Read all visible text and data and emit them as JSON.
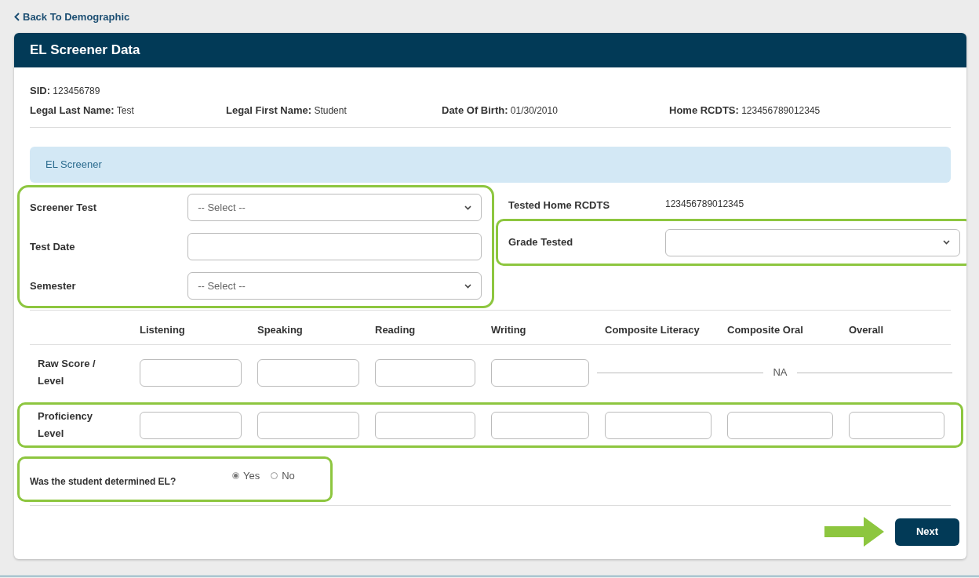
{
  "back_link": "Back To Demographic",
  "title": "EL Screener Data",
  "student_info": [
    {
      "label": "SID:",
      "value": "123456789"
    },
    {
      "label": "Legal Last Name:",
      "value": "Test"
    },
    {
      "label": "Legal First Name:",
      "value": "Student"
    },
    {
      "label": "Date Of Birth:",
      "value": "01/30/2010"
    },
    {
      "label": "Home RCDTS:",
      "value": "123456789012345"
    }
  ],
  "section_title": "EL Screener",
  "left_fields": {
    "highlighted": true,
    "fields": [
      {
        "label": "Screener Test",
        "kind": "select",
        "value": "-- Select --"
      },
      {
        "label": "Test Date",
        "kind": "text"
      },
      {
        "label": "Semester",
        "kind": "select",
        "value": "-- Select --"
      }
    ]
  },
  "right_fields": [
    {
      "label": "Tested Home RCDTS",
      "kind": "static",
      "value": "123456789012345",
      "highlighted": false
    },
    {
      "label": "Grade Tested",
      "kind": "select",
      "highlighted": true
    }
  ],
  "scores": {
    "columns": [
      "Listening",
      "Speaking",
      "Reading",
      "Writing",
      "Composite Literacy",
      "Composite Oral",
      "Overall"
    ],
    "rows": [
      {
        "label": "Raw Score / Level",
        "highlighted": false,
        "cells": [
          {
            "kind": "input"
          },
          {
            "kind": "input"
          },
          {
            "kind": "input"
          },
          {
            "kind": "input"
          },
          {
            "kind": "line"
          },
          {
            "kind": "na",
            "text": "NA"
          },
          {
            "kind": "line"
          }
        ]
      },
      {
        "label": "Proficiency Level",
        "highlighted": true,
        "cells": [
          {
            "kind": "input"
          },
          {
            "kind": "input"
          },
          {
            "kind": "input"
          },
          {
            "kind": "input"
          },
          {
            "kind": "input"
          },
          {
            "kind": "input"
          },
          {
            "kind": "input"
          }
        ]
      }
    ]
  },
  "question": {
    "text": "Was the student determined EL?",
    "highlighted": true,
    "options": [
      {
        "label": "Yes",
        "selected": true
      },
      {
        "label": "No",
        "selected": false
      }
    ]
  },
  "next_arrow": true,
  "next_button": "Next"
}
